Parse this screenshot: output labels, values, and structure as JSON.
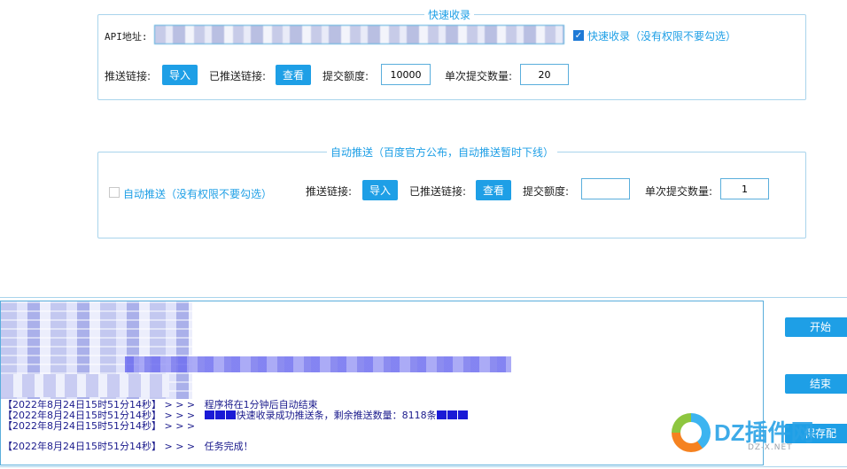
{
  "quick_index": {
    "title": "快速收录",
    "api_label": "API地址:",
    "quick_checkbox_label": "快速收录（没有权限不要勾选）",
    "quick_checked": true,
    "push_links_label": "推送链接:",
    "import_button": "导入",
    "pushed_links_label": "已推送链接:",
    "view_button": "查看",
    "quota_label": "提交额度:",
    "quota_value": "10000",
    "batch_label": "单次提交数量:",
    "batch_value": "20"
  },
  "auto_push": {
    "title": "自动推送（百度官方公布，自动推送暂时下线）",
    "checkbox_label": "自动推送（没有权限不要勾选）",
    "checked": false,
    "push_links_label": "推送链接:",
    "import_button": "导入",
    "pushed_links_label": "已推送链接:",
    "view_button": "查看",
    "quota_label": "提交额度:",
    "quota_value": "",
    "batch_label": "单次提交数量:",
    "batch_value": "1"
  },
  "log": {
    "lines": [
      {
        "time": "【2022年8月24日15时51分14秒】",
        "arrows": "> > >",
        "msg": "程序将在1分钟后自动结束"
      },
      {
        "time": "【2022年8月24日15时51分14秒】",
        "arrows": "> > >",
        "msg": "快速收录成功推送条，剩余推送数量：8118条"
      },
      {
        "time": "【2022年8月24日15时51分14秒】",
        "arrows": "> > >",
        "msg": ""
      },
      {
        "time": "【2022年8月24日15时51分14秒】",
        "arrows": "> > >",
        "msg": "任务完成！"
      }
    ]
  },
  "side_buttons": {
    "start": "开始",
    "stop": "结束",
    "save": "保存配"
  },
  "watermark": {
    "text": "DZ插件网",
    "sub": "DZ-X.NET"
  },
  "colors": {
    "accent": "#1e9fe6",
    "border": "#a9d4ec",
    "log_text": "#1a1a8c"
  }
}
